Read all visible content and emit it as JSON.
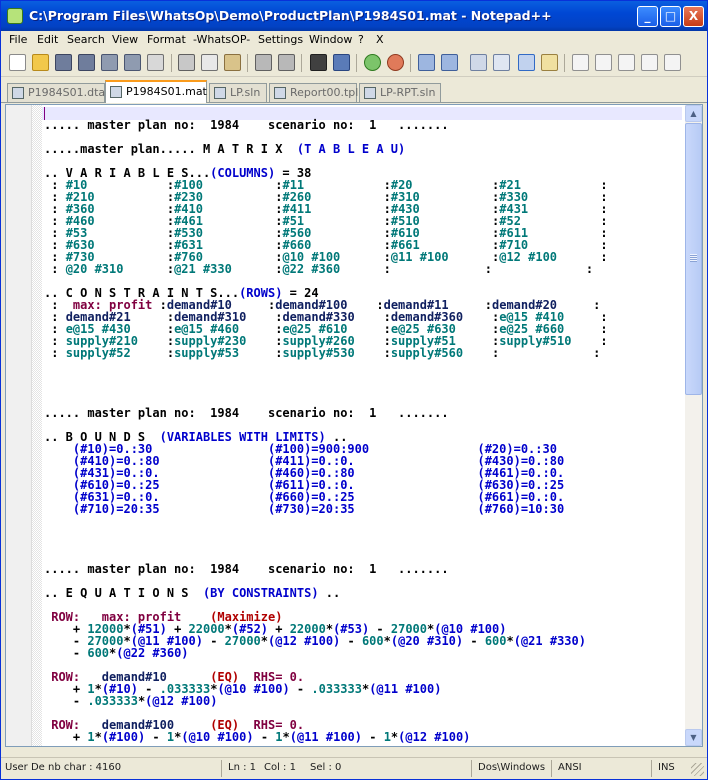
{
  "window": {
    "title": "C:\\Program Files\\WhatsOp\\Demo\\ProductPlan\\P1984S01.mat - Notepad++",
    "min_glyph": "_",
    "max_glyph": "□",
    "close_glyph": "X"
  },
  "menu": [
    "File",
    "Edit",
    "Search",
    "View",
    "Format",
    "-WhatsOP-",
    "Settings",
    "Window",
    "?",
    "X"
  ],
  "toolbar_icons": [
    "new-file-icon",
    "open-folder-icon",
    "save-icon",
    "save-all-icon",
    "close-icon",
    "close-all-icon",
    "print-icon",
    "cut-icon",
    "copy-icon",
    "paste-icon",
    "undo-icon",
    "redo-icon",
    "find-icon",
    "replace-icon",
    "zoom-in-icon",
    "zoom-out-icon",
    "sync-vertical-icon",
    "sync-horizontal-icon",
    "word-wrap-icon",
    "show-all-chars-icon",
    "indent-guide-icon",
    "user-lang-icon",
    "record-macro-icon",
    "stop-record-icon",
    "play-macro-icon",
    "play-multiple-icon",
    "save-macro-icon"
  ],
  "tabs": [
    {
      "label": "P1984S01.dta",
      "active": false
    },
    {
      "label": "P1984S01.mat",
      "active": true
    },
    {
      "label": "LP.sln",
      "active": false
    },
    {
      "label": "Report00.tpl",
      "active": false
    },
    {
      "label": "LP-RPT.sln",
      "active": false
    }
  ],
  "editor_lines": [
    [],
    [
      [
        "b",
        "..... master plan no:  1984    scenario no:  1   ......."
      ]
    ],
    [],
    [
      [
        "b",
        ".....master plan..... M A T R I X  "
      ],
      [
        "bl",
        "(T A B L E A U)"
      ]
    ],
    [],
    [
      [
        "b",
        ".. V A R I A B L E S..."
      ],
      [
        "bl",
        "(COLUMNS)"
      ],
      [
        "b",
        " = 38"
      ]
    ],
    [
      [
        "b",
        " : "
      ],
      [
        "tl",
        "#10"
      ],
      [
        "b",
        "           :"
      ],
      [
        "tl",
        "#100"
      ],
      [
        "b",
        "          :"
      ],
      [
        "tl",
        "#11"
      ],
      [
        "b",
        "           :"
      ],
      [
        "tl",
        "#20"
      ],
      [
        "b",
        "           :"
      ],
      [
        "tl",
        "#21"
      ],
      [
        "b",
        "           :"
      ]
    ],
    [
      [
        "b",
        " : "
      ],
      [
        "tl",
        "#210"
      ],
      [
        "b",
        "          :"
      ],
      [
        "tl",
        "#230"
      ],
      [
        "b",
        "          :"
      ],
      [
        "tl",
        "#260"
      ],
      [
        "b",
        "          :"
      ],
      [
        "tl",
        "#310"
      ],
      [
        "b",
        "          :"
      ],
      [
        "tl",
        "#330"
      ],
      [
        "b",
        "          :"
      ]
    ],
    [
      [
        "b",
        " : "
      ],
      [
        "tl",
        "#360"
      ],
      [
        "b",
        "          :"
      ],
      [
        "tl",
        "#410"
      ],
      [
        "b",
        "          :"
      ],
      [
        "tl",
        "#411"
      ],
      [
        "b",
        "          :"
      ],
      [
        "tl",
        "#430"
      ],
      [
        "b",
        "          :"
      ],
      [
        "tl",
        "#431"
      ],
      [
        "b",
        "          :"
      ]
    ],
    [
      [
        "b",
        " : "
      ],
      [
        "tl",
        "#460"
      ],
      [
        "b",
        "          :"
      ],
      [
        "tl",
        "#461"
      ],
      [
        "b",
        "          :"
      ],
      [
        "tl",
        "#51"
      ],
      [
        "b",
        "           :"
      ],
      [
        "tl",
        "#510"
      ],
      [
        "b",
        "          :"
      ],
      [
        "tl",
        "#52"
      ],
      [
        "b",
        "           :"
      ]
    ],
    [
      [
        "b",
        " : "
      ],
      [
        "tl",
        "#53"
      ],
      [
        "b",
        "           :"
      ],
      [
        "tl",
        "#530"
      ],
      [
        "b",
        "          :"
      ],
      [
        "tl",
        "#560"
      ],
      [
        "b",
        "          :"
      ],
      [
        "tl",
        "#610"
      ],
      [
        "b",
        "          :"
      ],
      [
        "tl",
        "#611"
      ],
      [
        "b",
        "          :"
      ]
    ],
    [
      [
        "b",
        " : "
      ],
      [
        "tl",
        "#630"
      ],
      [
        "b",
        "          :"
      ],
      [
        "tl",
        "#631"
      ],
      [
        "b",
        "          :"
      ],
      [
        "tl",
        "#660"
      ],
      [
        "b",
        "          :"
      ],
      [
        "tl",
        "#661"
      ],
      [
        "b",
        "          :"
      ],
      [
        "tl",
        "#710"
      ],
      [
        "b",
        "          :"
      ]
    ],
    [
      [
        "b",
        " : "
      ],
      [
        "tl",
        "#730"
      ],
      [
        "b",
        "          :"
      ],
      [
        "tl",
        "#760"
      ],
      [
        "b",
        "          :"
      ],
      [
        "tl",
        "@10 #100"
      ],
      [
        "b",
        "      :"
      ],
      [
        "tl",
        "@11 #100"
      ],
      [
        "b",
        "      :"
      ],
      [
        "tl",
        "@12 #100"
      ],
      [
        "b",
        "      :"
      ]
    ],
    [
      [
        "b",
        " : "
      ],
      [
        "tl",
        "@20 #310"
      ],
      [
        "b",
        "      :"
      ],
      [
        "tl",
        "@21 #330"
      ],
      [
        "b",
        "      :"
      ],
      [
        "tl",
        "@22 #360"
      ],
      [
        "b",
        "      :             :             :"
      ]
    ],
    [],
    [
      [
        "b",
        ".. C O N S T R A I N T S..."
      ],
      [
        "bl",
        "(ROWS)"
      ],
      [
        "b",
        " = 24"
      ]
    ],
    [
      [
        "b",
        " :  "
      ],
      [
        "pu",
        "max: profit"
      ],
      [
        "b",
        " :"
      ],
      [
        "dk",
        "demand#10"
      ],
      [
        "b",
        "     :"
      ],
      [
        "dk",
        "demand#100"
      ],
      [
        "b",
        "    :"
      ],
      [
        "dk",
        "demand#11"
      ],
      [
        "b",
        "     :"
      ],
      [
        "dk",
        "demand#20"
      ],
      [
        "b",
        "     :"
      ]
    ],
    [
      [
        "b",
        " : "
      ],
      [
        "dk",
        "demand#21"
      ],
      [
        "b",
        "     :"
      ],
      [
        "dk",
        "demand#310"
      ],
      [
        "b",
        "    :"
      ],
      [
        "dk",
        "demand#330"
      ],
      [
        "b",
        "    :"
      ],
      [
        "dk",
        "demand#360"
      ],
      [
        "b",
        "    :"
      ],
      [
        "tl",
        "e@15 #410"
      ],
      [
        "b",
        "     :"
      ]
    ],
    [
      [
        "b",
        " : "
      ],
      [
        "tl",
        "e@15 #430"
      ],
      [
        "b",
        "     :"
      ],
      [
        "tl",
        "e@15 #460"
      ],
      [
        "b",
        "     :"
      ],
      [
        "tl",
        "e@25 #610"
      ],
      [
        "b",
        "     :"
      ],
      [
        "tl",
        "e@25 #630"
      ],
      [
        "b",
        "     :"
      ],
      [
        "tl",
        "e@25 #660"
      ],
      [
        "b",
        "     :"
      ]
    ],
    [
      [
        "b",
        " : "
      ],
      [
        "tl",
        "supply#210"
      ],
      [
        "b",
        "    :"
      ],
      [
        "tl",
        "supply#230"
      ],
      [
        "b",
        "    :"
      ],
      [
        "tl",
        "supply#260"
      ],
      [
        "b",
        "    :"
      ],
      [
        "tl",
        "supply#51"
      ],
      [
        "b",
        "     :"
      ],
      [
        "tl",
        "supply#510"
      ],
      [
        "b",
        "    :"
      ]
    ],
    [
      [
        "b",
        " : "
      ],
      [
        "tl",
        "supply#52"
      ],
      [
        "b",
        "     :"
      ],
      [
        "tl",
        "supply#53"
      ],
      [
        "b",
        "     :"
      ],
      [
        "tl",
        "supply#530"
      ],
      [
        "b",
        "    :"
      ],
      [
        "tl",
        "supply#560"
      ],
      [
        "b",
        "    :             :"
      ]
    ],
    [],
    [],
    [],
    [],
    [
      [
        "b",
        "..... master plan no:  1984    scenario no:  1   ......."
      ]
    ],
    [],
    [
      [
        "b",
        ".. B O U N D S  "
      ],
      [
        "bl",
        "(VARIABLES WITH LIMITS)"
      ],
      [
        "b",
        " .."
      ]
    ],
    [
      [
        "bl",
        "    (#10)=0.:30                (#100)=900:900               (#20)=0.:30"
      ]
    ],
    [
      [
        "bl",
        "    (#410)=0.:80               (#411)=0.:0.                 (#430)=0.:80"
      ]
    ],
    [
      [
        "bl",
        "    (#431)=0.:0.               (#460)=0.:80                 (#461)=0.:0."
      ]
    ],
    [
      [
        "bl",
        "    (#610)=0.:25               (#611)=0.:0.                 (#630)=0.:25"
      ]
    ],
    [
      [
        "bl",
        "    (#631)=0.:0.               (#660)=0.:25                 (#661)=0.:0."
      ]
    ],
    [
      [
        "bl",
        "    (#710)=20:35               (#730)=20:35                 (#760)=10:30"
      ]
    ],
    [],
    [],
    [],
    [],
    [
      [
        "b",
        "..... master plan no:  1984    scenario no:  1   ......."
      ]
    ],
    [],
    [
      [
        "b",
        ".. E Q U A T I O N S  "
      ],
      [
        "bl",
        "(BY CONSTRAINTS)"
      ],
      [
        "b",
        " .."
      ]
    ],
    [],
    [
      [
        "pu",
        " ROW:   max: profit    "
      ],
      [
        "rd",
        "(Maximize)"
      ]
    ],
    [
      [
        "b",
        "    + "
      ],
      [
        "tl",
        "12000"
      ],
      [
        "b",
        "*"
      ],
      [
        "bl",
        "(#51)"
      ],
      [
        "b",
        " + "
      ],
      [
        "tl",
        "22000"
      ],
      [
        "b",
        "*"
      ],
      [
        "bl",
        "(#52)"
      ],
      [
        "b",
        " + "
      ],
      [
        "tl",
        "22000"
      ],
      [
        "b",
        "*"
      ],
      [
        "bl",
        "(#53)"
      ],
      [
        "b",
        " - "
      ],
      [
        "tl",
        "27000"
      ],
      [
        "b",
        "*"
      ],
      [
        "bl",
        "(@10 #100)"
      ]
    ],
    [
      [
        "b",
        "    - "
      ],
      [
        "tl",
        "27000"
      ],
      [
        "b",
        "*"
      ],
      [
        "bl",
        "(@11 #100)"
      ],
      [
        "b",
        " - "
      ],
      [
        "tl",
        "27000"
      ],
      [
        "b",
        "*"
      ],
      [
        "bl",
        "(@12 #100)"
      ],
      [
        "b",
        " - "
      ],
      [
        "tl",
        "600"
      ],
      [
        "b",
        "*"
      ],
      [
        "bl",
        "(@20 #310)"
      ],
      [
        "b",
        " - "
      ],
      [
        "tl",
        "600"
      ],
      [
        "b",
        "*"
      ],
      [
        "bl",
        "(@21 #330)"
      ]
    ],
    [
      [
        "b",
        "    - "
      ],
      [
        "tl",
        "600"
      ],
      [
        "b",
        "*"
      ],
      [
        "bl",
        "(@22 #360)"
      ]
    ],
    [],
    [
      [
        "pu",
        " ROW:  "
      ],
      [
        "dk",
        " demand#10"
      ],
      [
        "b",
        "      "
      ],
      [
        "rd",
        "(EQ)"
      ],
      [
        "b",
        "  "
      ],
      [
        "pu",
        "RHS= 0."
      ]
    ],
    [
      [
        "b",
        "    + "
      ],
      [
        "tl",
        "1"
      ],
      [
        "b",
        "*"
      ],
      [
        "bl",
        "(#10)"
      ],
      [
        "b",
        " - "
      ],
      [
        "tl",
        ".033333"
      ],
      [
        "b",
        "*"
      ],
      [
        "bl",
        "(@10 #100)"
      ],
      [
        "b",
        " - "
      ],
      [
        "tl",
        ".033333"
      ],
      [
        "b",
        "*"
      ],
      [
        "bl",
        "(@11 #100)"
      ]
    ],
    [
      [
        "b",
        "    - "
      ],
      [
        "tl",
        ".033333"
      ],
      [
        "b",
        "*"
      ],
      [
        "bl",
        "(@12 #100)"
      ]
    ],
    [],
    [
      [
        "pu",
        " ROW:  "
      ],
      [
        "dk",
        " demand#100"
      ],
      [
        "b",
        "     "
      ],
      [
        "rd",
        "(EQ)"
      ],
      [
        "b",
        "  "
      ],
      [
        "pu",
        "RHS= 0."
      ]
    ],
    [
      [
        "b",
        "    + "
      ],
      [
        "tl",
        "1"
      ],
      [
        "b",
        "*"
      ],
      [
        "bl",
        "(#100)"
      ],
      [
        "b",
        " - "
      ],
      [
        "tl",
        "1"
      ],
      [
        "b",
        "*"
      ],
      [
        "bl",
        "(@10 #100)"
      ],
      [
        "b",
        " - "
      ],
      [
        "tl",
        "1"
      ],
      [
        "b",
        "*"
      ],
      [
        "bl",
        "(@11 #100)"
      ],
      [
        "b",
        " - "
      ],
      [
        "tl",
        "1"
      ],
      [
        "b",
        "*"
      ],
      [
        "bl",
        "(@12 #100)"
      ]
    ]
  ],
  "status": {
    "nb_char": "User De nb char : 4160",
    "ln": "Ln : 1",
    "col": "Col : 1",
    "sel": "Sel : 0",
    "eol": "Dos\\Windows",
    "encoding": "ANSI",
    "mode": "INS"
  }
}
